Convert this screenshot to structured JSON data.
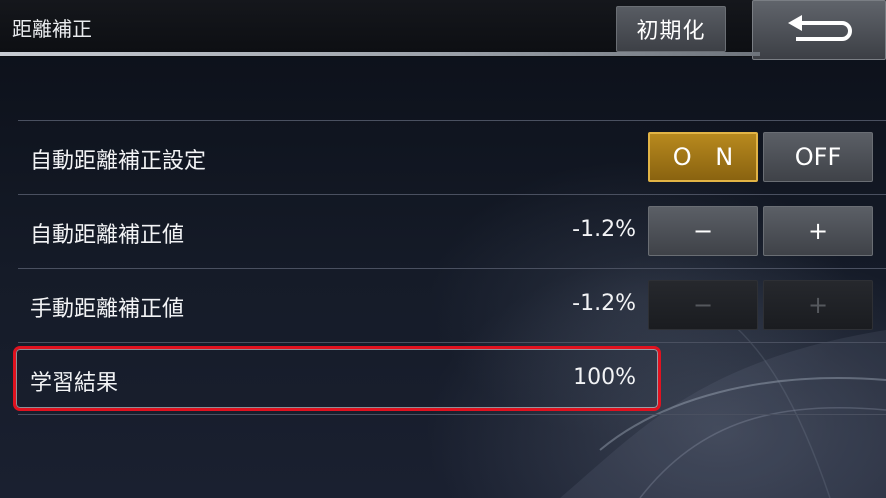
{
  "header": {
    "title": "距離補正",
    "reset_label": "初期化",
    "back_icon": "back-arrow-icon"
  },
  "rows": [
    {
      "label": "自動距離補正設定",
      "on_label": "O N",
      "off_label": "OFF",
      "selected": "ON"
    },
    {
      "label": "自動距離補正値",
      "value": "-1.2%",
      "minus": "−",
      "plus": "+"
    },
    {
      "label": "手動距離補正値",
      "value": "-1.2%",
      "minus": "−",
      "plus": "+",
      "disabled": true
    },
    {
      "label": "学習結果",
      "value": "100%"
    }
  ],
  "colors": {
    "accent_on": "#b8891e",
    "highlight": "#e0121f"
  }
}
